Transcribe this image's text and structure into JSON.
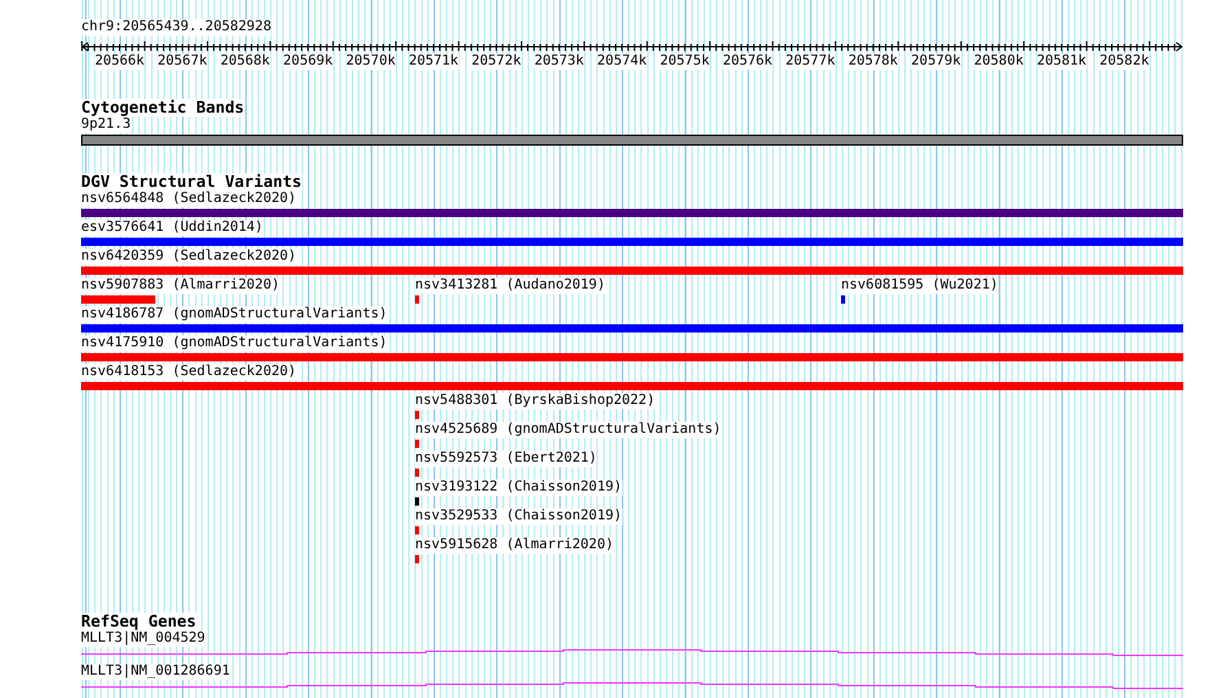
{
  "locus": "chr9:20565439..20582928",
  "ruler": {
    "labels": [
      "20566k",
      "20567k",
      "20568k",
      "20569k",
      "20570k",
      "20571k",
      "20572k",
      "20573k",
      "20574k",
      "20575k",
      "20576k",
      "20577k",
      "20578k",
      "20579k",
      "20580k",
      "20581k",
      "20582k"
    ]
  },
  "cytogenetic_bands": {
    "title": "Cytogenetic Bands",
    "band": {
      "label": "9p21.3"
    }
  },
  "dgv": {
    "title": "DGV Structural Variants",
    "rows": [
      {
        "features": [
          {
            "label": "nsv6564848 (Sedlazeck2020)",
            "kind": "full",
            "color": "#4b0082"
          }
        ]
      },
      {
        "features": [
          {
            "label": "esv3576641 (Uddin2014)",
            "kind": "full",
            "color": "#0000ff"
          }
        ]
      },
      {
        "features": [
          {
            "label": "nsv6420359 (Sedlazeck2020)",
            "kind": "full",
            "color": "#ff0000"
          }
        ]
      },
      {
        "features": [
          {
            "label": "nsv5907883 (Almarri2020)",
            "kind": "partial",
            "color": "#ff0000"
          },
          {
            "label": "nsv3413281 (Audano2019)",
            "kind": "point",
            "color": "#ff0000"
          },
          {
            "label": "nsv6081595 (Wu2021)",
            "kind": "point",
            "color": "#0000ff"
          }
        ]
      },
      {
        "features": [
          {
            "label": "nsv4186787 (gnomADStructuralVariants)",
            "kind": "full",
            "color": "#0000ff"
          }
        ]
      },
      {
        "features": [
          {
            "label": "nsv4175910 (gnomADStructuralVariants)",
            "kind": "full",
            "color": "#ff0000"
          }
        ]
      },
      {
        "features": [
          {
            "label": "nsv6418153 (Sedlazeck2020)",
            "kind": "full",
            "color": "#ff0000"
          }
        ]
      },
      {
        "features": [
          {
            "label": "nsv5488301 (ByrskaBishop2022)",
            "kind": "point",
            "color": "#ff0000"
          }
        ]
      },
      {
        "features": [
          {
            "label": "nsv4525689 (gnomADStructuralVariants)",
            "kind": "point",
            "color": "#ff0000"
          }
        ]
      },
      {
        "features": [
          {
            "label": "nsv5592573 (Ebert2021)",
            "kind": "point",
            "color": "#ff0000"
          }
        ]
      },
      {
        "features": [
          {
            "label": "nsv3193122 (Chaisson2019)",
            "kind": "point",
            "color": "#000000"
          }
        ]
      },
      {
        "features": [
          {
            "label": "nsv3529533 (Chaisson2019)",
            "kind": "point",
            "color": "#ff0000"
          }
        ]
      },
      {
        "features": [
          {
            "label": "nsv5915628 (Almarri2020)",
            "kind": "point",
            "color": "#ff0000"
          }
        ]
      }
    ]
  },
  "refseq": {
    "title": "RefSeq Genes",
    "genes": [
      {
        "label": "MLLT3|NM_004529"
      },
      {
        "label": "MLLT3|NM_001286691"
      }
    ]
  }
}
